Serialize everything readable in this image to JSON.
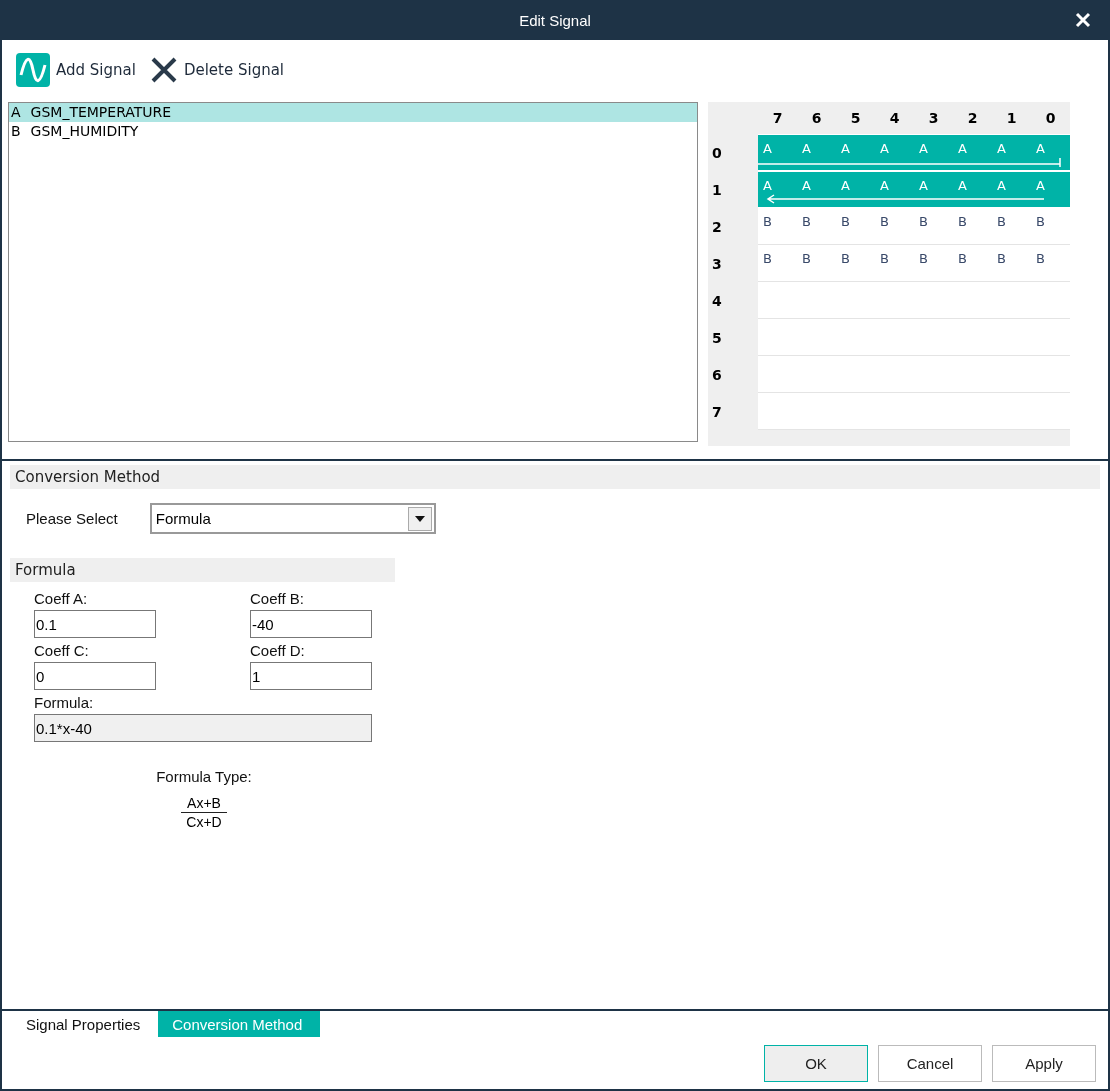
{
  "window": {
    "title": "Edit Signal"
  },
  "toolbar": [
    {
      "kind": "add",
      "label": "Add Signal"
    },
    {
      "kind": "delete",
      "label": "Delete Signal"
    }
  ],
  "signals": [
    {
      "letter": "A",
      "name": "GSM_TEMPERATURE",
      "selected": true
    },
    {
      "letter": "B",
      "name": "GSM_HUMIDITY",
      "selected": false
    }
  ],
  "bit_grid": {
    "columns": [
      "7",
      "6",
      "5",
      "4",
      "3",
      "2",
      "1",
      "0"
    ],
    "rows": [
      {
        "label": "0",
        "kind": "signal-start",
        "cells": [
          "A",
          "A",
          "A",
          "A",
          "A",
          "A",
          "A",
          "A"
        ]
      },
      {
        "label": "1",
        "kind": "signal-end",
        "cells": [
          "A",
          "A",
          "A",
          "A",
          "A",
          "A",
          "A",
          "A"
        ]
      },
      {
        "label": "2",
        "kind": "plain",
        "cells": [
          "B",
          "B",
          "B",
          "B",
          "B",
          "B",
          "B",
          "B"
        ]
      },
      {
        "label": "3",
        "kind": "plain",
        "cells": [
          "B",
          "B",
          "B",
          "B",
          "B",
          "B",
          "B",
          "B"
        ]
      },
      {
        "label": "4",
        "kind": "plain",
        "cells": []
      },
      {
        "label": "5",
        "kind": "plain",
        "cells": []
      },
      {
        "label": "6",
        "kind": "plain",
        "cells": []
      },
      {
        "label": "7",
        "kind": "plain",
        "cells": []
      }
    ]
  },
  "conversion": {
    "title": "Conversion Method",
    "select_label": "Please Select",
    "select_value": "Formula",
    "formula": {
      "title": "Formula",
      "coeffs": [
        {
          "label": "Coeff A:",
          "value": "0.1"
        },
        {
          "label": "Coeff B:",
          "value": "-40"
        },
        {
          "label": "Coeff C:",
          "value": "0"
        },
        {
          "label": "Coeff D:",
          "value": "1"
        }
      ],
      "result_label": "Formula:",
      "result_value": "0.1*x-40",
      "type_label": "Formula Type:",
      "numerator": "Ax+B",
      "denominator": "Cx+D"
    }
  },
  "tabs": [
    {
      "label": "Signal Properties",
      "selected": false
    },
    {
      "label": "Conversion Method",
      "selected": true
    }
  ],
  "buttons": [
    {
      "label": "OK",
      "selected": true
    },
    {
      "label": "Cancel",
      "selected": false
    },
    {
      "label": "Apply",
      "selected": false
    }
  ]
}
